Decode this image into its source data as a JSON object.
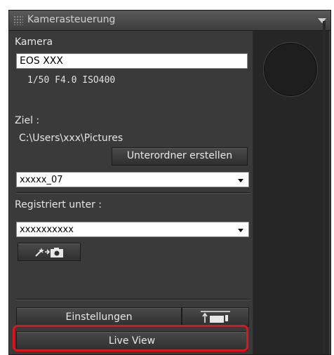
{
  "window": {
    "title": "Kamerasteuerung"
  },
  "camera": {
    "section_label": "Kamera",
    "model_value": "EOS XXX",
    "exposure_readout": "1/50  F4.0  ISO400"
  },
  "destination": {
    "label": "Ziel :",
    "path": "C:\\Users\\xxx\\Pictures",
    "create_subfolder_button": "Unterordner erstellen",
    "folder_select_value": "xxxxx_07"
  },
  "registration": {
    "label": "Registriert unter :",
    "select_value": "xxxxxxxxxx"
  },
  "buttons": {
    "settings": "Einstellungen",
    "live_view": "Live View"
  },
  "colors": {
    "highlight": "#e0141c",
    "panel_bg": "#3a3a3a"
  },
  "icons": {
    "transfer_to_camera": "wand-to-camera-icon",
    "upload_to_camera": "upload-camera-icon"
  }
}
